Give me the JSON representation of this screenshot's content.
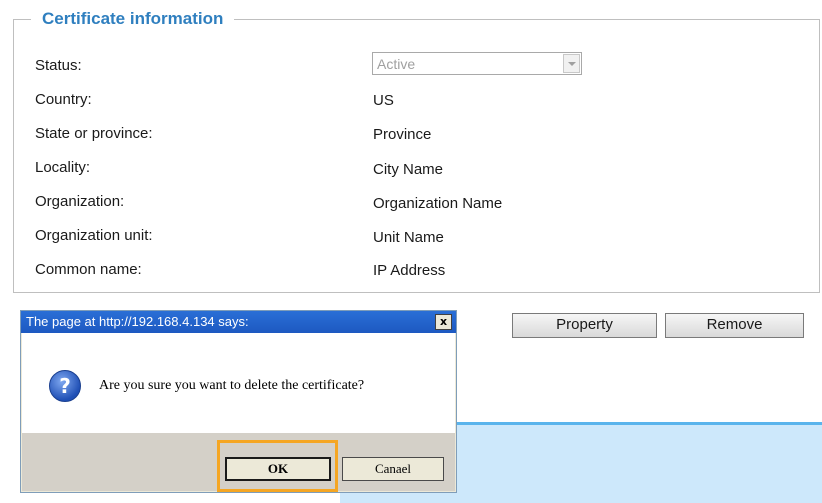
{
  "certificate": {
    "legend": "Certificate information",
    "rows": [
      {
        "label": "Status:",
        "value": "Active"
      },
      {
        "label": "Country:",
        "value": "US"
      },
      {
        "label": "State or province:",
        "value": "Province"
      },
      {
        "label": "Locality:",
        "value": "City Name"
      },
      {
        "label": "Organization:",
        "value": "Organization Name"
      },
      {
        "label": "Organization unit:",
        "value": "Unit Name"
      },
      {
        "label": "Common name:",
        "value": "IP Address"
      }
    ]
  },
  "buttons": {
    "property": "Property",
    "remove": "Remove"
  },
  "dialog": {
    "title": "The page at http://192.168.4.134 says:",
    "close": "x",
    "message": "Are you sure you want to delete the certificate?",
    "icon": "question-icon",
    "ok": "OK",
    "cancel": "Canael"
  },
  "colors": {
    "legend": "#2f7fbf",
    "highlight": "#f5a623",
    "band": "#cde8fb",
    "band_line": "#5ab4ec"
  }
}
